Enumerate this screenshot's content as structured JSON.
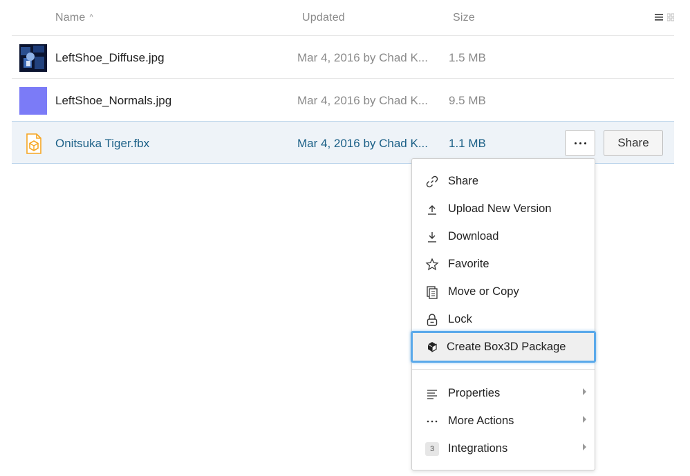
{
  "columns": {
    "name": "Name",
    "updated": "Updated",
    "size": "Size"
  },
  "files": [
    {
      "name": "LeftShoe_Diffuse.jpg",
      "updated": "Mar 4, 2016 by Chad K...",
      "size": "1.5 MB",
      "thumb": "diffuse-image-thumbnail"
    },
    {
      "name": "LeftShoe_Normals.jpg",
      "updated": "Mar 4, 2016 by Chad K...",
      "size": "9.5 MB",
      "thumb": "normals-image-thumbnail"
    },
    {
      "name": "Onitsuka Tiger.fbx",
      "updated": "Mar 4, 2016 by Chad K...",
      "size": "1.1 MB",
      "thumb": "3d-file-icon"
    }
  ],
  "row_actions": {
    "share_label": "Share"
  },
  "context_menu": {
    "items": [
      {
        "label": "Share",
        "icon": "link-icon"
      },
      {
        "label": "Upload New Version",
        "icon": "upload-icon"
      },
      {
        "label": "Download",
        "icon": "download-icon"
      },
      {
        "label": "Favorite",
        "icon": "star-icon"
      },
      {
        "label": "Move or Copy",
        "icon": "copy-icon"
      },
      {
        "label": "Lock",
        "icon": "lock-icon"
      },
      {
        "label": "Create Box3D Package",
        "icon": "box3d-icon",
        "focused": true
      }
    ],
    "submenus": [
      {
        "label": "Properties",
        "icon": "properties-icon"
      },
      {
        "label": "More Actions",
        "icon": "ellipsis-icon"
      },
      {
        "label": "Integrations",
        "icon": "integrations-badge",
        "badge": "3"
      }
    ]
  },
  "colors": {
    "selected_row_bg": "#eef3f8",
    "selected_text": "#1a5f86",
    "focus_ring": "#5aa9ea",
    "normals_thumb": "#7b7bf7",
    "fbx_icon": "#f5a623"
  }
}
